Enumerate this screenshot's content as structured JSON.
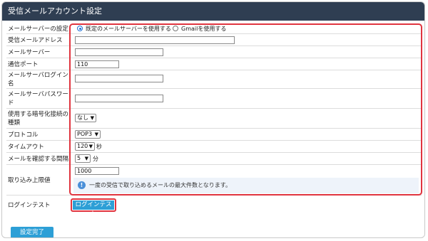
{
  "header": {
    "title": "受信メールアカウント設定"
  },
  "rows": {
    "server_setting": {
      "label": "メールサーバーの設定",
      "option_default": "既定のメールサーバーを使用する",
      "option_gmail": "Gmailを使用する",
      "selected": "default"
    },
    "address": {
      "label": "受信メールアドレス",
      "value": ""
    },
    "server": {
      "label": "メールサーバー",
      "value": ""
    },
    "port": {
      "label": "通信ポート",
      "value": "110"
    },
    "login": {
      "label": "メールサーバログイン名",
      "value": ""
    },
    "password": {
      "label": "メールサーバパスワード",
      "value": ""
    },
    "encryption": {
      "label": "使用する暗号化接続の種類",
      "value": "なし"
    },
    "protocol": {
      "label": "プロトコル",
      "value": "POP3"
    },
    "timeout": {
      "label": "タイムアウト",
      "value": "120",
      "unit": "秒"
    },
    "interval": {
      "label": "メールを確認する間隔",
      "value": "5",
      "unit": "分"
    },
    "limit": {
      "label": "取り込み上限値",
      "value": "1000",
      "info": "一度の受信で取り込めるメールの最大件数となります。"
    },
    "login_test": {
      "label": "ログインテスト",
      "button": "ログインテスト"
    }
  },
  "footer": {
    "submit": "設定完了"
  },
  "colors": {
    "header_bg": "#2f3e52",
    "highlight": "#e0343f",
    "button": "#2d9fd6",
    "info_bg": "#eef3fa"
  }
}
